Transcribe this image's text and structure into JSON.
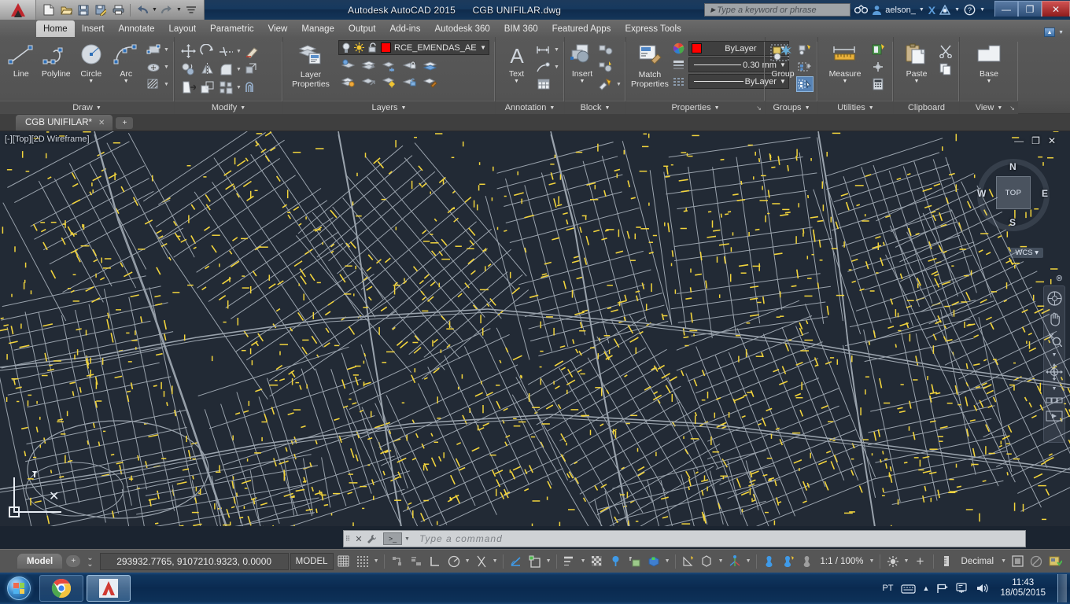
{
  "titlebar": {
    "app_title": "Autodesk AutoCAD 2015",
    "document_title": "CGB UNIFILAR.dwg",
    "search_placeholder": "Type a keyword or phrase",
    "user_name": "aelson_",
    "quick_access": [
      "new-icon",
      "open-icon",
      "save-icon",
      "save-as-icon",
      "plot-icon",
      "undo-icon",
      "redo-icon",
      "customize-icon"
    ],
    "window_buttons": {
      "minimize": "—",
      "restore": "❐",
      "close": "✕"
    }
  },
  "ribbon_tabs": [
    {
      "label": "Home",
      "active": true
    },
    {
      "label": "Insert",
      "active": false
    },
    {
      "label": "Annotate",
      "active": false
    },
    {
      "label": "Layout",
      "active": false
    },
    {
      "label": "Parametric",
      "active": false
    },
    {
      "label": "View",
      "active": false
    },
    {
      "label": "Manage",
      "active": false
    },
    {
      "label": "Output",
      "active": false
    },
    {
      "label": "Add-ins",
      "active": false
    },
    {
      "label": "Autodesk 360",
      "active": false
    },
    {
      "label": "BIM 360",
      "active": false
    },
    {
      "label": "Featured Apps",
      "active": false
    },
    {
      "label": "Express Tools",
      "active": false
    }
  ],
  "panels": {
    "draw": {
      "caption": "Draw",
      "buttons": [
        {
          "label": "Line",
          "icon": "line-icon"
        },
        {
          "label": "Polyline",
          "icon": "polyline-icon"
        },
        {
          "label": "Circle",
          "icon": "circle-icon",
          "has_dropdown": true
        },
        {
          "label": "Arc",
          "icon": "arc-icon",
          "has_dropdown": true
        }
      ],
      "small_icons": [
        "rectangle-icon",
        "ellipse-icon",
        "hatch-icon"
      ]
    },
    "modify": {
      "caption": "Modify",
      "small_icons": [
        "move-icon",
        "rotate-icon",
        "trim-icon",
        "erase-icon",
        "copy-icon",
        "mirror-icon",
        "fillet-icon",
        "array-icon",
        "stretch-icon",
        "scale-icon",
        "explode-icon",
        "offset-icon"
      ]
    },
    "layers": {
      "caption": "Layers",
      "big_button": {
        "label_line1": "Layer",
        "label_line2": "Properties",
        "icon": "layer-properties-icon"
      },
      "current_layer": "RCE_EMENDAS_AER",
      "layer_color": "#ff0000",
      "layer_state_icons": [
        "lightbulb-icon",
        "sun-icon",
        "unlock-icon"
      ],
      "grid_icons": [
        "layer-isolate-icon",
        "layer-off-icon",
        "layer-freeze-icon",
        "layer-lock-icon",
        "layer-make-current-icon",
        "layer-unisolate-icon",
        "layer-match-icon",
        "layer-on-icon",
        "layer-unlock-icon",
        "layer-change-icon"
      ]
    },
    "annotation": {
      "caption": "Annotation",
      "big_button": {
        "label": "Text",
        "icon": "text-icon",
        "has_dropdown": true
      },
      "small_icons": [
        "dimension-icon",
        "leader-icon",
        "table-icon"
      ]
    },
    "block": {
      "caption": "Block",
      "big_button": {
        "label": "Insert",
        "icon": "insert-block-icon",
        "has_dropdown": true
      },
      "small_icons": [
        "create-block-icon",
        "edit-block-icon",
        "define-attribute-icon"
      ]
    },
    "properties": {
      "caption": "Properties",
      "color_value": "ByLayer",
      "color_swatch": "#ff0000",
      "lineweight_value": "0.30 mm",
      "linetype_value": "ByLayer",
      "row_icons": [
        "color-wheel-icon",
        "lineweight-icon",
        "linetype-icon"
      ],
      "dialog_launcher": "↘"
    },
    "groups": {
      "caption": "Groups",
      "big_button": {
        "label": "Group",
        "icon": "group-icon"
      },
      "small_icons": [
        "group-edit-icon",
        "ungroup-icon",
        "group-selection-icon"
      ]
    },
    "utilities": {
      "caption": "Utilities",
      "big_button": {
        "label": "Measure",
        "icon": "measure-icon",
        "has_dropdown": true
      },
      "small_icons": [
        "quick-select-icon",
        "point-id-icon",
        "calculator-icon"
      ]
    },
    "clipboard": {
      "caption": "Clipboard",
      "big_button": {
        "label": "Paste",
        "icon": "paste-icon",
        "has_dropdown": true
      },
      "small_icons": [
        "cut-icon",
        "copy-clip-icon"
      ]
    },
    "view": {
      "caption": "View",
      "big_button": {
        "label": "Base",
        "icon": "base-view-icon",
        "has_dropdown": true
      },
      "dialog_launcher": "↘"
    }
  },
  "document_tabs": {
    "tabs": [
      {
        "label": "CGB UNIFILAR*",
        "close": "✕"
      }
    ],
    "new_tab": "+"
  },
  "viewport": {
    "label": "[-][Top][2D Wireframe]",
    "window_buttons": {
      "minimize": "—",
      "restore": "❐",
      "close": "✕"
    },
    "viewcube": {
      "top": "TOP",
      "north": "N",
      "south": "S",
      "east": "E",
      "west": "W"
    },
    "wcs_tag": "WCS",
    "nav_icons": [
      "steering-wheel-icon",
      "pan-icon",
      "zoom-icon",
      "orbit-icon",
      "showmotion-icon"
    ]
  },
  "command_line": {
    "placeholder": "Type a command",
    "close_icon": "✕",
    "options_icon": "customize-icon",
    "prompt_icon": ">_"
  },
  "status_bar": {
    "model_tab": "Model",
    "add_layout": "+",
    "coordinates": "293932.7765, 9107210.9323, 0.0000",
    "space_toggle": "MODEL",
    "scale": "1:1 / 100%",
    "units": "Decimal",
    "toggles": [
      "grid-display-icon",
      "snap-mode-icon",
      "infer-constraints-icon",
      "dynamic-input-icon",
      "ortho-mode-icon",
      "polar-tracking-icon",
      "isometric-drafting-icon",
      "object-snap-tracking-icon",
      "object-snap-icon",
      "lineweight-display-icon",
      "transparency-icon",
      "selection-cycling-icon",
      "3d-object-snap-icon",
      "dynamic-ucs-icon",
      "annotation-visibility-icon",
      "autoscale-icon",
      "workspace-icon",
      "annotation-monitor-icon",
      "hardware-accel-icon",
      "isolate-objects-icon",
      "clean-screen-icon"
    ]
  },
  "taskbar": {
    "start": "start-orb-icon",
    "items": [
      {
        "name": "chrome-icon",
        "active": false
      },
      {
        "name": "autocad-icon",
        "active": true
      }
    ],
    "tray": {
      "language": "PT",
      "icons": [
        "keyboard-icon",
        "show-hidden-icon",
        "network-icon",
        "action-center-icon",
        "volume-icon"
      ],
      "time": "11:43",
      "date": "18/05/2015"
    }
  },
  "colors": {
    "canvas_bg": "#222a35",
    "line_gray": "#9aa3ad",
    "line_yellow": "#f2d43c",
    "accent_red": "#ff0000",
    "accent_blue": "#3f9ae8"
  }
}
